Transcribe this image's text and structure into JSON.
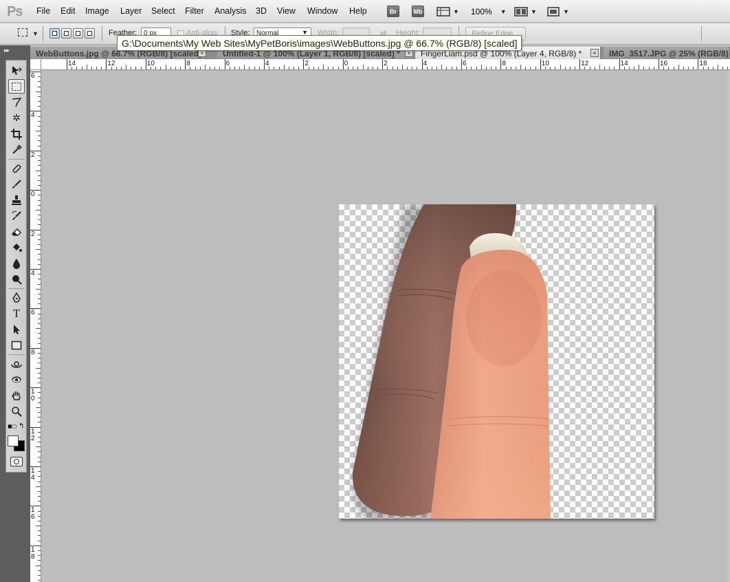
{
  "app": {
    "logo": "Ps",
    "menu": [
      "File",
      "Edit",
      "Image",
      "Layer",
      "Select",
      "Filter",
      "Analysis",
      "3D",
      "View",
      "Window",
      "Help"
    ],
    "bridge_label": "Br",
    "minibridge_label": "Mb",
    "zoom": "100%"
  },
  "options": {
    "feather_label": "Feather:",
    "feather_value": "0 px",
    "antialias_label": "Anti-alias",
    "style_label": "Style:",
    "style_value": "Normal",
    "width_label": "Width:",
    "height_label": "Height:",
    "refine_edge": "Refine Edge..."
  },
  "tooltip": "G:\\Documents\\My Web Sites\\MyPetBoris\\images\\WebButtons.jpg @ 66.7% (RGB/8) [scaled]",
  "tabs": [
    {
      "label": "WebButtons.jpg @ 66.7% (RGB/8) [scaled]",
      "active": false
    },
    {
      "label": "Untitled-1 @ 100% (Layer 1, RGB/8) [scaled] *",
      "active": false
    },
    {
      "label": "FingerLiam.psd @ 100% (Layer 4, RGB/8) *",
      "active": true
    },
    {
      "label": "IMG_3517.JPG @ 25% (RGB/8)",
      "active": false
    }
  ],
  "ruler_h": [
    "14",
    "12",
    "10",
    "8",
    "6",
    "4",
    "2",
    "0",
    "2",
    "4",
    "6",
    "8",
    "10",
    "12",
    "14",
    "16",
    "18"
  ],
  "ruler_v": [
    "6",
    "4",
    "2",
    "0",
    "2",
    "4",
    "6",
    "8",
    "10",
    "12",
    "14",
    "16",
    "18"
  ],
  "colors": {
    "foreground": "#ffffff",
    "background": "#000000"
  }
}
